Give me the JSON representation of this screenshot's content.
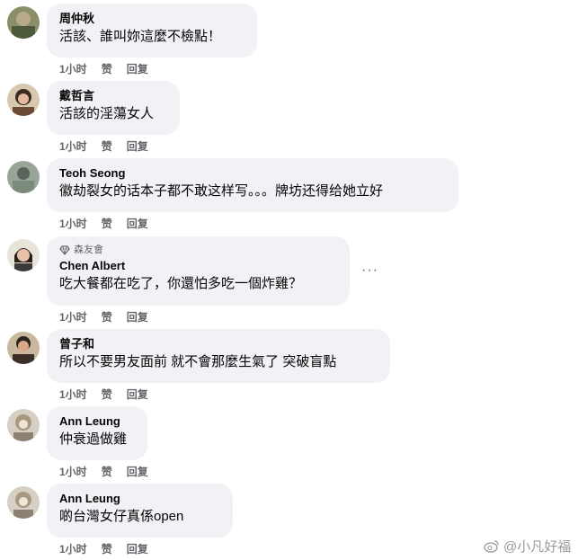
{
  "actions": {
    "time": "1小时",
    "like": "赞",
    "reply": "回复"
  },
  "more_label": "···",
  "comments": [
    {
      "name": "周仲秋",
      "text": "活該、誰叫妳這麼不檢點！"
    },
    {
      "name": "戴哲言",
      "text": "活該的淫蕩女人"
    },
    {
      "name": "Teoh Seong",
      "text": "徽劫裂女的话本子都不敢这样写。。。牌坊还得给她立好"
    },
    {
      "badge": "森友會",
      "name": "Chen Albert",
      "text": "吃大餐都在吃了，你還怕多吃一個炸雞？"
    },
    {
      "name": "曾子和",
      "text": "所以不要男友面前 就不會那麼生氣了 突破盲點"
    },
    {
      "name": "Ann Leung",
      "text": "仲衰過做雞"
    },
    {
      "name": "Ann Leung",
      "text": "啲台灣女仔真係open"
    }
  ],
  "watermark": "@小凡好福",
  "colors": {
    "bubble": "#f0f2f5",
    "secondary_text": "#65676b"
  }
}
